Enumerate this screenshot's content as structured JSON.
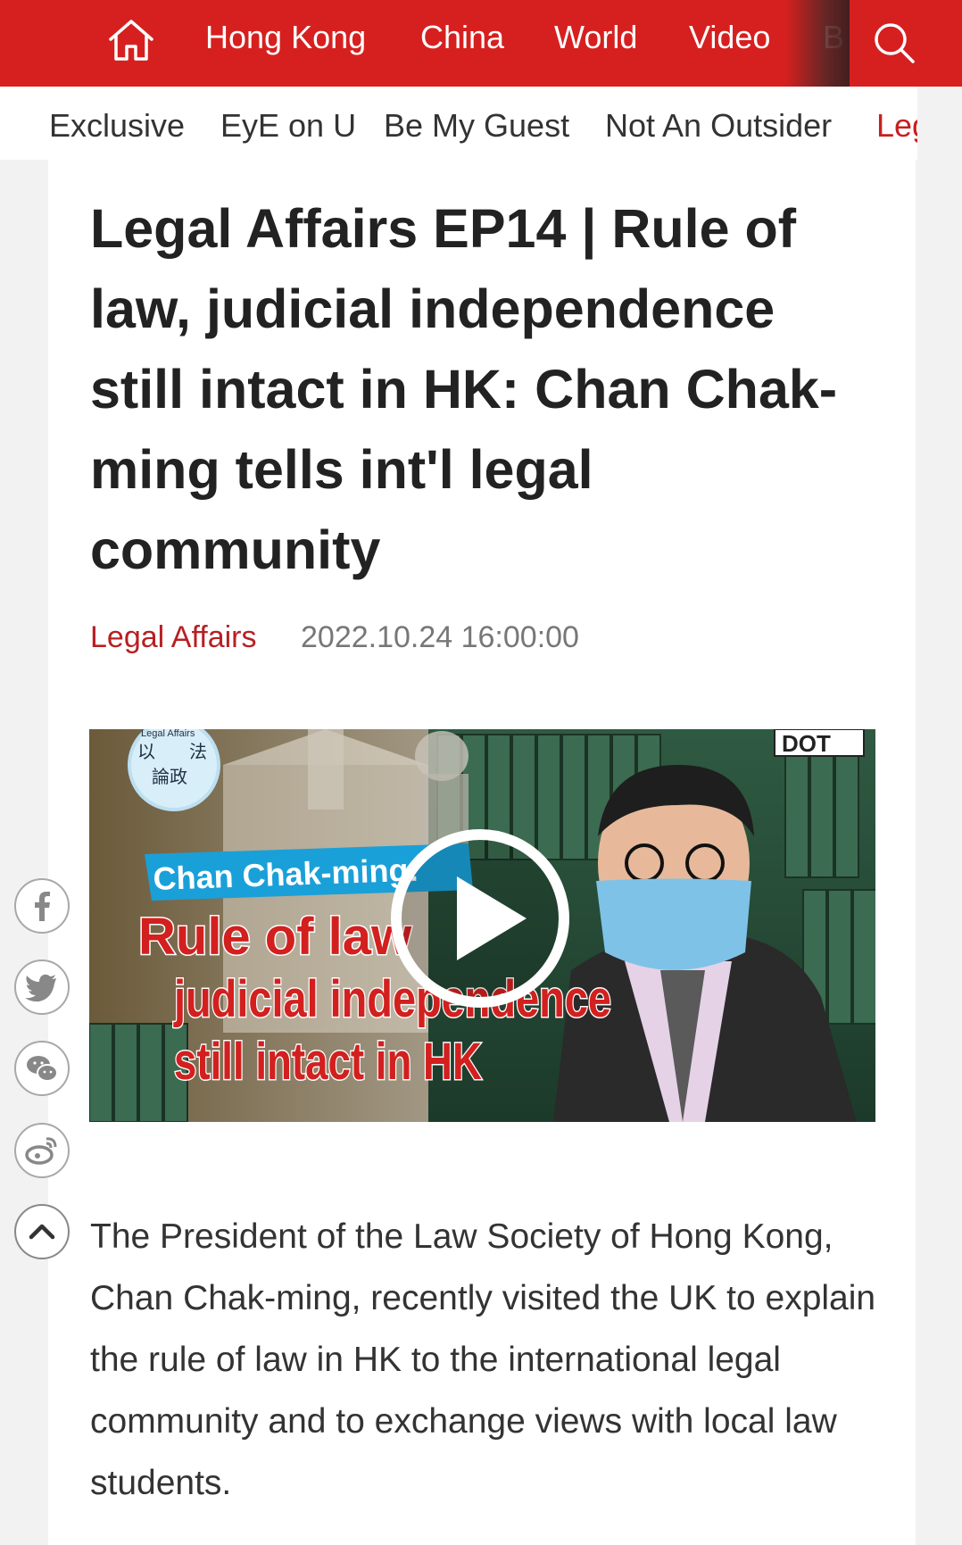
{
  "topnav": {
    "home_icon": "home-icon",
    "items": [
      "Hong Kong",
      "China",
      "World",
      "Video",
      "B"
    ],
    "search_icon": "search-icon"
  },
  "subnav": {
    "items": [
      "Exclusive",
      "EyE on U",
      "Be My Guest",
      "Not An Outsider",
      "Leg"
    ]
  },
  "article": {
    "title": "Legal Affairs EP14 | Rule of law, judicial independence still intact in HK: Chan Chak-ming tells int'l legal community",
    "category": "Legal Affairs",
    "date": "2022.10.24 16:00:00",
    "body": "The President of the Law Society of Hong Kong, Chan Chak-ming, recently visited the UK to explain the rule of law in HK to the international legal community and to exchange views with local law students."
  },
  "video": {
    "logo_small": "Legal Affairs",
    "logo_cn_1": "以",
    "logo_cn_2": "法",
    "logo_cn_3": "論政",
    "brand": "DOT",
    "caption_name": "Chan Chak-ming:",
    "caption_line1": "Rule of law",
    "caption_line2": "judicial independence",
    "caption_line3": "still intact in HK",
    "play_icon": "play-icon"
  },
  "share": {
    "icons": [
      "facebook-icon",
      "twitter-icon",
      "wechat-icon",
      "weibo-icon",
      "scroll-top-icon"
    ]
  },
  "colors": {
    "brand_red": "#d6201f",
    "category_red": "#b81f22",
    "caption_blue": "#1aa0d8"
  }
}
